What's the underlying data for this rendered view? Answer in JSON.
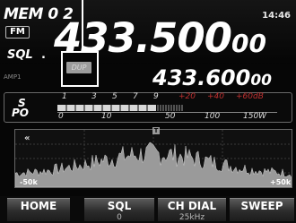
{
  "memory": {
    "label": "MEM 0 2"
  },
  "clock": {
    "time": "14:46"
  },
  "mode": {
    "badge": "FM"
  },
  "squelch": {
    "label": "SQL",
    "indicator": "."
  },
  "main_frequency": {
    "main": "433.500",
    "small": "00"
  },
  "sub_frequency": {
    "main": "433.600",
    "small": "00"
  },
  "duplex": {
    "badge": "DUP"
  },
  "amp": {
    "label": "AMP1"
  },
  "meter": {
    "s_label": "S",
    "po_label": "PO",
    "s_scale": [
      "1",
      "3",
      "5",
      "7",
      "9",
      "+20",
      "+40",
      "+60dB"
    ],
    "po_scale": [
      "0",
      "10",
      "50",
      "100",
      "150W"
    ]
  },
  "spectrum": {
    "left_span": "-50k",
    "right_span": "+50k",
    "marker": "T",
    "collapse_icon": "double-chevron-left"
  },
  "softkeys": [
    {
      "label": "HOME",
      "sub": ""
    },
    {
      "label": "SQL",
      "sub": "0"
    },
    {
      "label": "CH DIAL",
      "sub": "25kHz"
    },
    {
      "label": "SWEEP",
      "sub": ""
    }
  ],
  "colors": {
    "background": "#060606",
    "text": "#ffffff",
    "meter_red": "#c03030",
    "dup_badge": "#9c9c9c",
    "key_gradient_top": "#5a5a5a"
  }
}
